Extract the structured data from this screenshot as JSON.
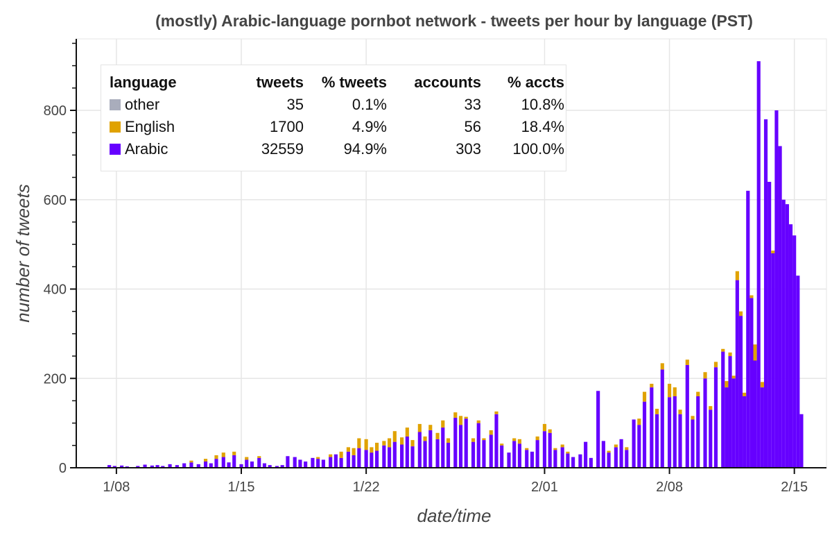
{
  "chart_data": {
    "type": "bar",
    "stacked": true,
    "title": "(mostly) Arabic-language pornbot network - tweets per hour by language (PST)",
    "xlabel": "date/time",
    "ylabel": "number of tweets",
    "ylim": [
      0,
      960
    ],
    "xlim_days": [
      5.75,
      47.8
    ],
    "yticks": [
      0,
      200,
      400,
      600,
      800
    ],
    "xticks": [
      {
        "day": 8,
        "label": "1/08"
      },
      {
        "day": 15,
        "label": "1/15"
      },
      {
        "day": 22,
        "label": "1/22"
      },
      {
        "day": 32,
        "label": "2/01"
      },
      {
        "day": 39,
        "label": "2/08"
      },
      {
        "day": 46,
        "label": "2/15"
      }
    ],
    "grid": true,
    "legend_position": "top-left",
    "colors": {
      "other": "#a9adbc",
      "English": "#e0a200",
      "Arabic": "#6600ff"
    },
    "legend": {
      "headers": [
        "language",
        "tweets",
        "% tweets",
        "accounts",
        "% accts"
      ],
      "rows": [
        {
          "language": "other",
          "tweets": "35",
          "pct_tweets": "0.1%",
          "accounts": "33",
          "pct_accts": "10.8%"
        },
        {
          "language": "English",
          "tweets": "1700",
          "pct_tweets": "4.9%",
          "accounts": "56",
          "pct_accts": "18.4%"
        },
        {
          "language": "Arabic",
          "tweets": "32559",
          "pct_tweets": "94.9%",
          "accounts": "303",
          "pct_accts": "100.0%"
        }
      ]
    },
    "bar_width_days": 0.2,
    "series_note": "sampled peak hourly values, x in days since Dec 31",
    "x": [
      7.6,
      7.9,
      8.3,
      8.6,
      9.2,
      9.6,
      10.0,
      10.3,
      10.6,
      11.0,
      11.4,
      11.8,
      12.2,
      12.6,
      13.0,
      13.3,
      13.6,
      14.0,
      14.3,
      14.6,
      15.0,
      15.3,
      15.6,
      16.0,
      16.3,
      16.6,
      17.0,
      17.3,
      17.6,
      18.0,
      18.3,
      18.6,
      19.0,
      19.3,
      19.6,
      20.0,
      20.3,
      20.6,
      21.0,
      21.3,
      21.6,
      22.0,
      22.3,
      22.6,
      23.0,
      23.3,
      23.6,
      24.0,
      24.3,
      24.6,
      25.0,
      25.3,
      25.6,
      26.0,
      26.3,
      26.6,
      27.0,
      27.3,
      27.6,
      28.0,
      28.3,
      28.6,
      29.0,
      29.3,
      29.6,
      30.0,
      30.3,
      30.6,
      31.0,
      31.3,
      31.6,
      32.0,
      32.3,
      32.6,
      33.0,
      33.3,
      33.6,
      34.0,
      34.3,
      34.6,
      35.0,
      35.3,
      35.6,
      36.0,
      36.3,
      36.6,
      37.0,
      37.3,
      37.6,
      38.0,
      38.3,
      38.6,
      39.0,
      39.3,
      39.6,
      40.0,
      40.3,
      40.6,
      41.0,
      41.3,
      41.6,
      42.0,
      42.2,
      42.4,
      42.6,
      42.8,
      43.0,
      43.2,
      43.4,
      43.6,
      43.8,
      44.0,
      44.2,
      44.4,
      44.6,
      44.8,
      45.0,
      45.2,
      45.4,
      45.6,
      45.8,
      46.0,
      46.2,
      46.4
    ],
    "series": [
      {
        "name": "Arabic",
        "values": [
          6,
          4,
          5,
          3,
          4,
          7,
          5,
          6,
          4,
          8,
          6,
          10,
          12,
          8,
          14,
          10,
          20,
          24,
          12,
          28,
          8,
          18,
          14,
          22,
          10,
          6,
          4,
          6,
          26,
          24,
          18,
          14,
          22,
          20,
          18,
          24,
          30,
          22,
          36,
          28,
          44,
          40,
          34,
          38,
          50,
          46,
          58,
          52,
          70,
          48,
          80,
          60,
          84,
          64,
          90,
          56,
          112,
          96,
          110,
          58,
          100,
          62,
          74,
          120,
          50,
          34,
          60,
          54,
          40,
          36,
          62,
          82,
          78,
          40,
          46,
          32,
          24,
          30,
          58,
          22,
          172,
          60,
          34,
          46,
          64,
          40,
          108,
          96,
          148,
          180,
          120,
          220,
          158,
          160,
          120,
          230,
          108,
          160,
          200,
          130,
          225,
          260,
          180,
          250,
          200,
          420,
          340,
          160,
          620,
          380,
          240,
          910,
          180,
          780,
          640,
          480,
          800,
          720,
          600,
          590,
          545,
          520,
          430,
          120
        ]
      },
      {
        "name": "English",
        "values": [
          0,
          0,
          0,
          0,
          0,
          0,
          0,
          0,
          0,
          0,
          0,
          0,
          4,
          0,
          6,
          0,
          8,
          10,
          0,
          8,
          0,
          6,
          0,
          4,
          0,
          0,
          0,
          0,
          0,
          0,
          0,
          0,
          0,
          4,
          0,
          6,
          0,
          14,
          10,
          16,
          22,
          24,
          12,
          18,
          10,
          20,
          24,
          16,
          20,
          14,
          18,
          10,
          12,
          14,
          16,
          10,
          12,
          20,
          4,
          8,
          6,
          4,
          10,
          6,
          4,
          0,
          6,
          10,
          4,
          0,
          8,
          16,
          8,
          4,
          6,
          4,
          0,
          0,
          0,
          0,
          0,
          0,
          4,
          6,
          0,
          6,
          0,
          14,
          22,
          8,
          12,
          14,
          30,
          20,
          10,
          12,
          8,
          10,
          14,
          8,
          12,
          6,
          14,
          8,
          6,
          20,
          10,
          8,
          0,
          6,
          36,
          0,
          12,
          0,
          0,
          6,
          0,
          0,
          0,
          0,
          0,
          0,
          0,
          0
        ]
      },
      {
        "name": "other",
        "values": [
          0,
          0,
          0,
          0,
          0,
          0,
          0,
          0,
          0,
          0,
          0,
          0,
          0,
          0,
          0,
          0,
          0,
          0,
          0,
          0,
          0,
          0,
          0,
          0,
          0,
          0,
          0,
          0,
          0,
          0,
          0,
          0,
          0,
          0,
          0,
          0,
          0,
          0,
          0,
          0,
          0,
          0,
          0,
          0,
          0,
          0,
          0,
          0,
          0,
          0,
          0,
          0,
          0,
          0,
          0,
          0,
          0,
          0,
          0,
          0,
          0,
          0,
          0,
          0,
          0,
          0,
          0,
          0,
          0,
          0,
          0,
          0,
          0,
          0,
          0,
          0,
          0,
          0,
          0,
          0,
          0,
          0,
          0,
          0,
          0,
          0,
          0,
          0,
          0,
          0,
          0,
          0,
          0,
          0,
          0,
          0,
          0,
          0,
          0,
          0,
          0,
          0,
          0,
          0,
          0,
          0,
          0,
          0,
          0,
          0,
          0,
          0,
          0,
          0,
          0,
          0,
          0,
          0,
          0,
          0,
          0,
          0,
          0,
          0
        ]
      }
    ]
  }
}
